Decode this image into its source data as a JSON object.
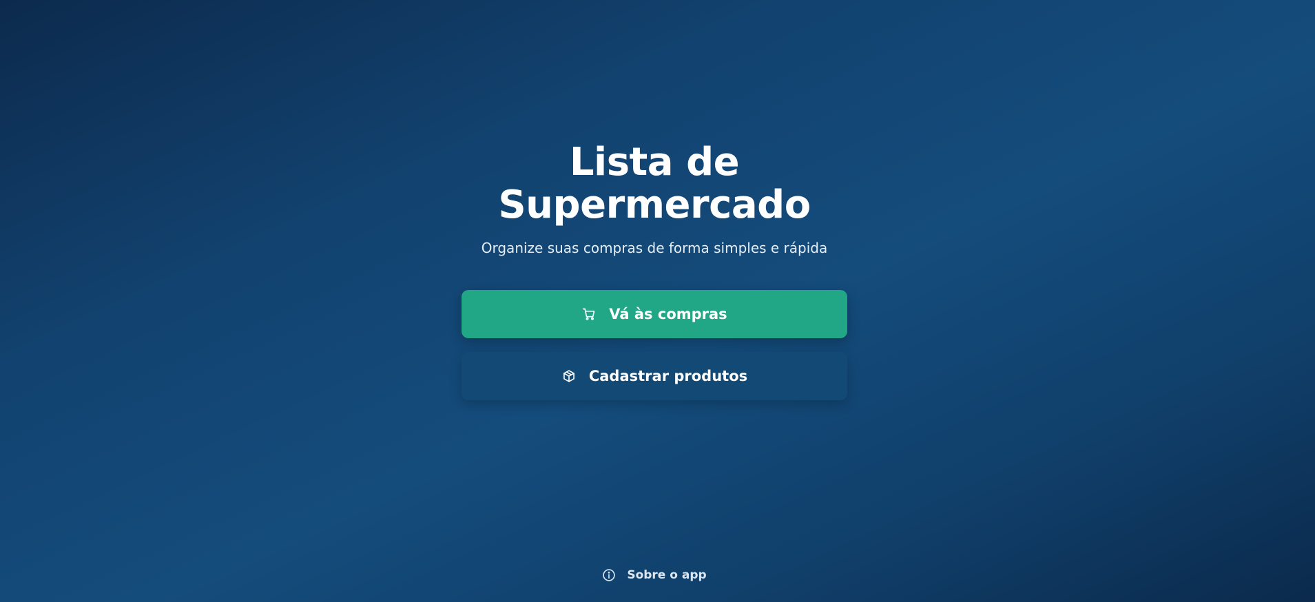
{
  "hero": {
    "title_line1": "Lista de",
    "title_line2": "Supermercado",
    "subtitle": "Organize suas compras de forma simples e rápida"
  },
  "actions": {
    "shop_label": "Vá às compras",
    "shop_icon": "cart-icon",
    "register_label": "Cadastrar produtos",
    "register_icon": "box-icon"
  },
  "footer": {
    "about_label": "Sobre o app",
    "about_icon": "info-icon"
  },
  "colors": {
    "primary_button": "#21a785",
    "secondary_button": "#134a75",
    "background_dark": "#0c2a4d",
    "background_light": "#144c7c"
  }
}
